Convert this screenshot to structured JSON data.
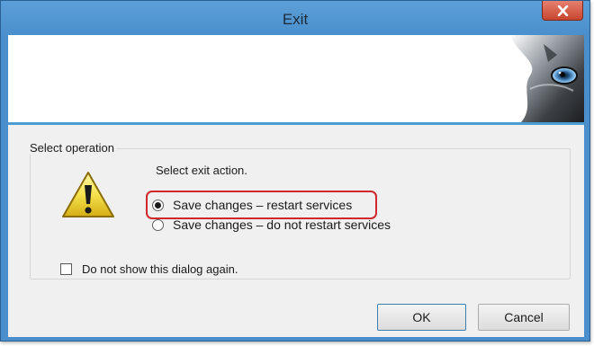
{
  "window": {
    "title": "Exit"
  },
  "banner": {
    "image": "wolf-eye-logo"
  },
  "icons": {
    "close": "close-icon",
    "warning": "warning-icon"
  },
  "colors": {
    "close_button": "#c7452f",
    "highlight_outline": "#d1262c",
    "banner_rule": "#4e9cd4",
    "window_frame": "#4a8fcc"
  },
  "group": {
    "legend": "Select operation",
    "instruction": "Select exit action.",
    "options": [
      {
        "label": "Save changes – restart services",
        "selected": true
      },
      {
        "label": "Save changes – do not restart services",
        "selected": false
      }
    ],
    "dont_show_again": {
      "label": "Do not show this dialog again.",
      "checked": false
    }
  },
  "buttons": {
    "ok": "OK",
    "cancel": "Cancel"
  }
}
